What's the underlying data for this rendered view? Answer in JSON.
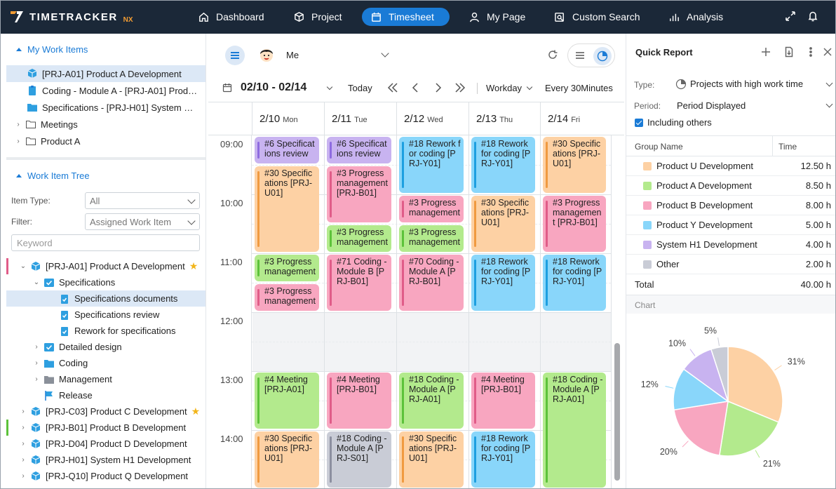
{
  "app": {
    "logo_main": "TIMETRACKER",
    "logo_suffix": "NX"
  },
  "nav": {
    "items": [
      {
        "label": "Dashboard",
        "icon": "home-icon"
      },
      {
        "label": "Project",
        "icon": "cube-icon"
      },
      {
        "label": "Timesheet",
        "icon": "calendar-icon",
        "active": true
      },
      {
        "label": "My Page",
        "icon": "user-icon"
      },
      {
        "label": "Custom Search",
        "icon": "search-doc-icon"
      },
      {
        "label": "Analysis",
        "icon": "bar-chart-icon"
      }
    ]
  },
  "my_work_items": {
    "title": "My Work Items",
    "items": [
      "[PRJ-A01] Product A Development",
      "Coding - Module A - [PRJ-A01] Prod…",
      "Specifications - [PRJ-H01] System …",
      "Meetings",
      "Product A"
    ]
  },
  "work_item_tree": {
    "title": "Work Item Tree",
    "item_type_label": "Item Type:",
    "item_type_value": "All",
    "filter_label": "Filter:",
    "filter_value": "Assigned Work Item",
    "keyword_placeholder": "Keyword",
    "nodes": [
      "[PRJ-A01] Product A Development",
      "Specifications",
      "Specifications documents",
      "Specifications review",
      "Rework for specifications",
      "Detailed design",
      "Coding",
      "Management",
      "Release",
      "[PRJ-C03] Product C Development",
      "[PRJ-B01] Product B Development",
      "[PRJ-D04] Product D Development",
      "[PRJ-H01] System H1 Development",
      "[PRJ-Q10] Product Q Development"
    ]
  },
  "timesheet": {
    "user": "Me",
    "range": "02/10 - 02/14",
    "today": "Today",
    "workday": "Workday",
    "interval": "Every 30Minutes",
    "days": [
      {
        "date": "2/10",
        "dow": "Mon"
      },
      {
        "date": "2/11",
        "dow": "Tue"
      },
      {
        "date": "2/12",
        "dow": "Wed"
      },
      {
        "date": "2/13",
        "dow": "Thu"
      },
      {
        "date": "2/14",
        "dow": "Fri"
      }
    ],
    "times": [
      "09:00",
      "10:00",
      "11:00",
      "12:00",
      "13:00",
      "14:00"
    ],
    "events": [
      {
        "day": 0,
        "start": "09:00",
        "end": "09:30",
        "color": "purple",
        "text": "#6 Specifications review"
      },
      {
        "day": 0,
        "start": "09:30",
        "end": "11:00",
        "color": "orange",
        "text": "#30 Specifications [PRJ-U01]"
      },
      {
        "day": 0,
        "start": "11:00",
        "end": "11:30",
        "color": "green",
        "text": "#3 Progress management"
      },
      {
        "day": 0,
        "start": "11:30",
        "end": "12:00",
        "color": "pink",
        "text": "#3 Progress management"
      },
      {
        "day": 0,
        "start": "13:00",
        "end": "14:00",
        "color": "green",
        "text": "#4 Meeting [PRJ-A01]"
      },
      {
        "day": 0,
        "start": "14:00",
        "end": "15:00",
        "color": "orange",
        "text": "#30 Specifications [PRJ-U01]"
      },
      {
        "day": 1,
        "start": "09:00",
        "end": "09:30",
        "color": "purple",
        "text": "#6 Specifications review"
      },
      {
        "day": 1,
        "start": "09:30",
        "end": "10:30",
        "color": "pink",
        "text": "#3 Progress management [PRJ-B01]"
      },
      {
        "day": 1,
        "start": "10:30",
        "end": "11:00",
        "color": "green",
        "text": "#3 Progress management"
      },
      {
        "day": 1,
        "start": "11:00",
        "end": "12:00",
        "color": "pink",
        "text": "#71 Coding - Module B [PRJ-B01]"
      },
      {
        "day": 1,
        "start": "13:00",
        "end": "14:00",
        "color": "pink",
        "text": "#4 Meeting [PRJ-B01]"
      },
      {
        "day": 1,
        "start": "14:00",
        "end": "15:00",
        "color": "gray",
        "text": "#18 Coding - Module A [PRJ-S01]"
      },
      {
        "day": 2,
        "start": "09:00",
        "end": "10:00",
        "color": "blue",
        "text": "#18 Rework for coding [PRJ-Y01]"
      },
      {
        "day": 2,
        "start": "10:00",
        "end": "10:30",
        "color": "pink",
        "text": "#3 Progress management"
      },
      {
        "day": 2,
        "start": "10:30",
        "end": "11:00",
        "color": "green",
        "text": "#3 Progress management"
      },
      {
        "day": 2,
        "start": "11:00",
        "end": "12:00",
        "color": "pink",
        "text": "#70 Coding - Module A [PRJ-B01]"
      },
      {
        "day": 2,
        "start": "13:00",
        "end": "14:00",
        "color": "green",
        "text": "#18 Coding - Module A [PRJ-A01]"
      },
      {
        "day": 2,
        "start": "14:00",
        "end": "15:00",
        "color": "orange",
        "text": "#30 Specifications [PRJ-U01]"
      },
      {
        "day": 3,
        "start": "09:00",
        "end": "10:00",
        "color": "blue",
        "text": "#18 Rework for coding [PRJ-Y01]"
      },
      {
        "day": 3,
        "start": "10:00",
        "end": "11:00",
        "color": "orange",
        "text": "#30 Specifications [PRJ-U01]"
      },
      {
        "day": 3,
        "start": "11:00",
        "end": "12:00",
        "color": "blue",
        "text": "#18 Rework for coding [PRJ-Y01]"
      },
      {
        "day": 3,
        "start": "13:00",
        "end": "14:00",
        "color": "pink",
        "text": "#4 Meeting [PRJ-B01]"
      },
      {
        "day": 3,
        "start": "14:00",
        "end": "15:00",
        "color": "blue",
        "text": "#18 Rework for coding [PRJ-Y01]"
      },
      {
        "day": 4,
        "start": "09:00",
        "end": "10:00",
        "color": "orange",
        "text": "#30 Specifications [PRJ-U01]"
      },
      {
        "day": 4,
        "start": "10:00",
        "end": "11:00",
        "color": "pink",
        "text": "#3 Progress management [PRJ-B01]"
      },
      {
        "day": 4,
        "start": "11:00",
        "end": "12:00",
        "color": "blue",
        "text": "#18 Rework for coding [PRJ-Y01]"
      },
      {
        "day": 4,
        "start": "13:00",
        "end": "15:00",
        "color": "green",
        "text": "#18 Coding - Module A [PRJ-A01]"
      }
    ]
  },
  "quick_report": {
    "title": "Quick Report",
    "type_label": "Type:",
    "type_value": "Projects with high work time",
    "period_label": "Period:",
    "period_value": "Period Displayed",
    "including_others": "Including others",
    "col_group": "Group Name",
    "col_time": "Time",
    "rows": [
      {
        "name": "Product U Development",
        "time": "12.50 h",
        "color": "#fdd1a4"
      },
      {
        "name": "Product A Development",
        "time": "8.50 h",
        "color": "#b3ea8d"
      },
      {
        "name": "Product B Development",
        "time": "8.00 h",
        "color": "#f8a6c0"
      },
      {
        "name": "Product Y Development",
        "time": "5.00 h",
        "color": "#89d6fa"
      },
      {
        "name": "System H1 Development",
        "time": "4.00 h",
        "color": "#c8b3f0"
      },
      {
        "name": "Other",
        "time": "2.00 h",
        "color": "#c9ccd6"
      }
    ],
    "total_label": "Total",
    "total_value": "40.00 h",
    "chart_label": "Chart"
  },
  "chart_data": {
    "type": "pie",
    "labels": [
      "Product U Development",
      "Product A Development",
      "Product B Development",
      "Product Y Development",
      "System H1 Development",
      "Other"
    ],
    "values": [
      12.5,
      8.5,
      8.0,
      5.0,
      4.0,
      2.0
    ],
    "percent_labels": [
      "31%",
      "21%",
      "20%",
      "12%",
      "10%",
      "5%"
    ],
    "colors": [
      "#fdd1a4",
      "#b3ea8d",
      "#f8a6c0",
      "#89d6fa",
      "#c8b3f0",
      "#c9ccd6"
    ]
  }
}
